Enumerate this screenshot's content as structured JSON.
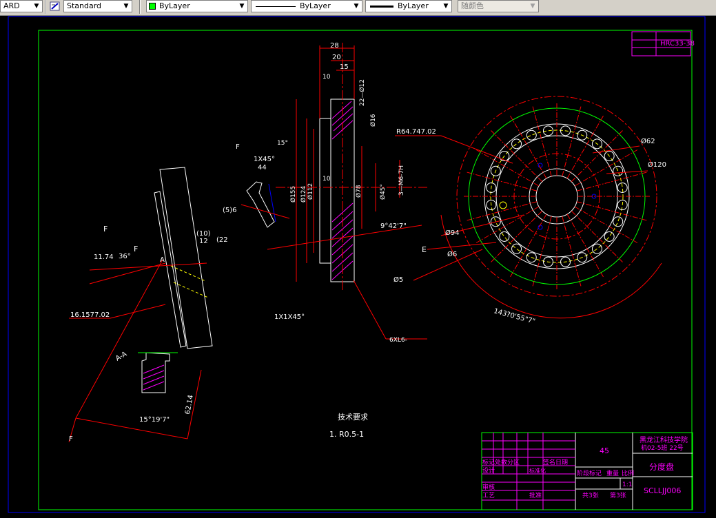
{
  "toolbar": {
    "textstyle_partial": "ARD",
    "dimstyle": "Standard",
    "layer_color": "ByLayer",
    "linetype": "ByLayer",
    "lineweight": "ByLayer",
    "plotstyle": "随颜色",
    "layer_color_swatch": "#00ff00"
  },
  "drawing": {
    "dims_top": [
      "28",
      "20",
      "15",
      "10",
      "22—Ø12",
      "Ø16",
      "15°"
    ],
    "dims_left": [
      "Ø155",
      "Ø124",
      "Ø112",
      "Ø78"
    ],
    "dims_mid": [
      "Ø45°",
      "3—M6-7H",
      "10",
      "9°42'7\""
    ],
    "dims_detail_f": [
      "F",
      "1X45°",
      "44",
      "(5)6",
      "(10)",
      "12",
      "(22"
    ],
    "dims_detail_left": [
      "F",
      "F",
      "11.74",
      "36°",
      "A",
      "16.1577.02",
      "1X1X45°"
    ],
    "dims_section": [
      "A-A",
      "15°19'7\"",
      "62.14",
      "F"
    ],
    "dims_right": [
      "R64.747.02",
      "Ø62",
      "Ø120",
      "Ø94",
      "Ø6",
      "Ø5",
      "143?0'55\"7\"",
      "E"
    ],
    "note_leader": "6XL6-",
    "tech_title": "技术要求",
    "tech_line": "1.  R0.5-1",
    "tb_hardness": "HRC33-38",
    "title_block": {
      "material": "45",
      "school": "黑龙江科技学院",
      "class": "机02-5班 22号",
      "part_name": "分度盘",
      "drawing_no": "SCLLJJ006",
      "scale": "1:1",
      "row_mark": "标记处数分区",
      "row_sign": "签名日期",
      "row_design": "设计",
      "row_std": "标准化",
      "row_stage": "阶段标记",
      "row_weight": "重量",
      "row_ratio": "比例",
      "row_review": "审核",
      "row_process": "工艺",
      "row_approve": "批准",
      "sheets_total": "共3张",
      "sheet_no": "第3张"
    }
  }
}
